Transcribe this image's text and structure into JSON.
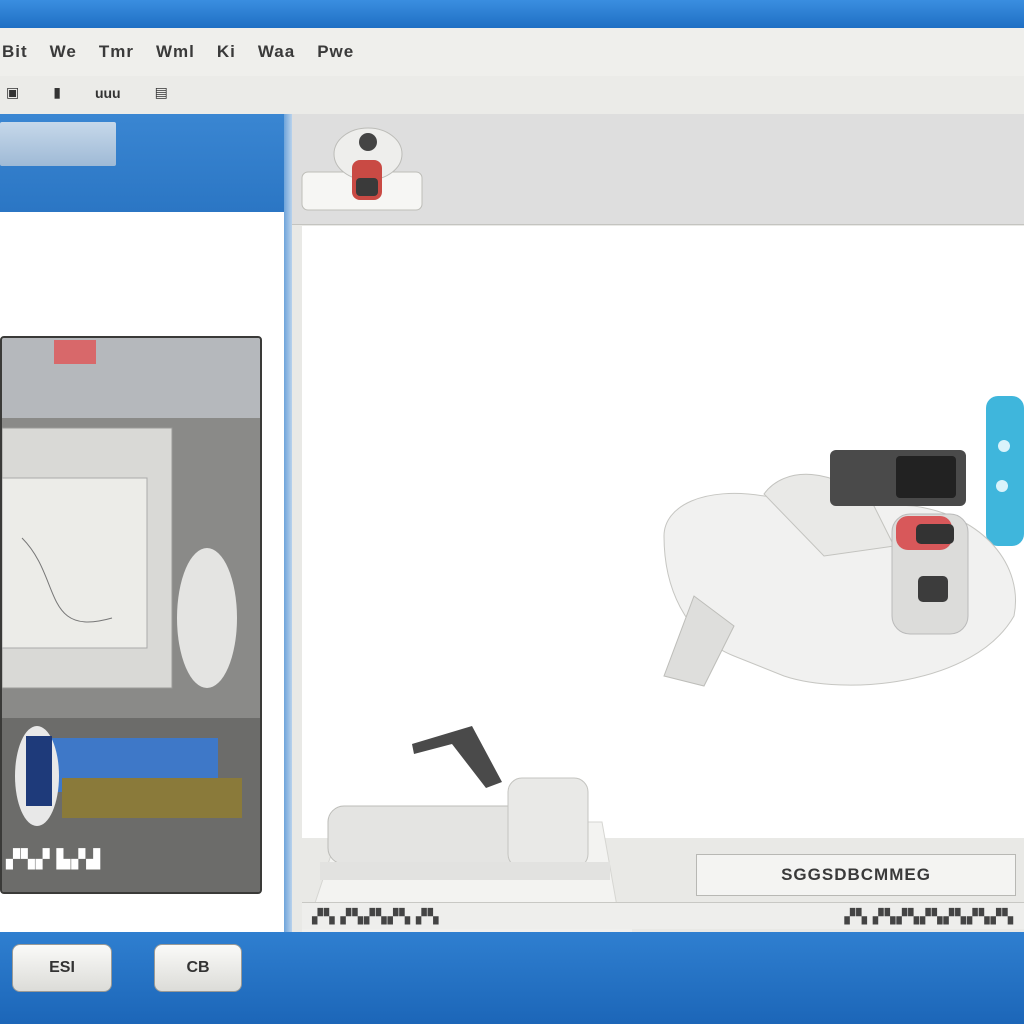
{
  "menu": {
    "items": [
      "Bit",
      "We",
      "Tmr",
      "Wml",
      "Ki",
      "Waa",
      "Pwe"
    ]
  },
  "toolbar": {
    "items": [
      "▣",
      "▮",
      "uuu",
      "▤"
    ]
  },
  "left_panel": {
    "thumbnail_caption": "▞▚▞ ▙▞▟"
  },
  "main": {
    "status_field": "SGGSDBCMMEG",
    "status_left": "▞▚ ▞▚▞▚▞▚ ▞▚",
    "status_right": "▞▚ ▞▚▞▚▞▚▞▚▞▚▞▚"
  },
  "buttons": {
    "first_label": "ESI",
    "second_label": "CB"
  },
  "colors": {
    "accent": "#2f7fd0",
    "panel": "#efefec",
    "canvas": "#ffffff"
  }
}
